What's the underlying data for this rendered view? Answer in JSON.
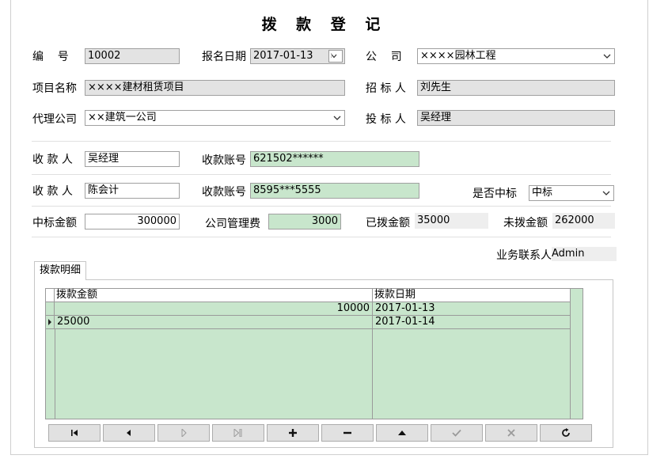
{
  "title": "拨 款 登 记",
  "labels": {
    "bianhao": "编    号",
    "baoming_date": "报名日期",
    "gongsi": "公    司",
    "xiangmu": "项目名称",
    "zhaobiao": "招 标 人",
    "daili": "代理公司",
    "toubiao": "投 标 人",
    "shoukuan1": "收 款 人",
    "zhanghao1": "收款账号",
    "shoukuan2": "收 款 人",
    "zhanghao2": "收款账号",
    "zhongbiao_q": "是否中标",
    "zhongbiao_amt": "中标金额",
    "guanli_fee": "公司管理费",
    "yibo": "已拨金额",
    "weibo": "未拨金额",
    "lianxiren": "业务联系人"
  },
  "fields": {
    "bianhao": "10002",
    "baoming_date": "2017-01-13",
    "gongsi": "××××园林工程",
    "xiangmu": "××××建材租赁项目",
    "zhaobiao": "刘先生",
    "daili": "××建筑一公司",
    "toubiao": "吴经理",
    "shoukuan1": "吴经理",
    "zhanghao1": "621502******",
    "shoukuan2": "陈会计",
    "zhanghao2": "8595***5555",
    "zhongbiao_q": "中标",
    "zhongbiao_amt": "300000",
    "guanli_fee": "3000",
    "yibo": "35000",
    "weibo": "262000",
    "lianxiren": "Admin"
  },
  "tab": {
    "label": "拨款明细"
  },
  "grid": {
    "columns": [
      "拨款金额",
      "拨款日期"
    ],
    "rows": [
      {
        "amount": "10000",
        "date": "2017-01-13"
      },
      {
        "amount": "25000",
        "date": "2017-01-14"
      }
    ]
  },
  "navigator": [
    "first-icon",
    "prev-icon",
    "next-icon",
    "last-icon",
    "insert-icon",
    "delete-icon",
    "edit-icon",
    "post-icon",
    "cancel-icon",
    "refresh-icon"
  ]
}
